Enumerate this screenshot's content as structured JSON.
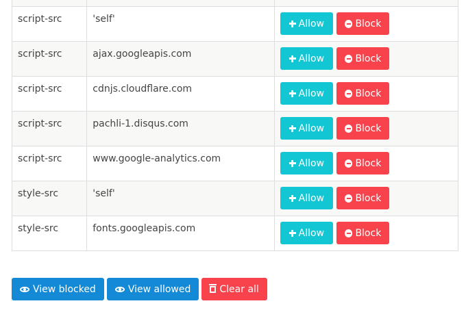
{
  "rows": [
    {
      "directive": "script-src",
      "source": "'self'"
    },
    {
      "directive": "script-src",
      "source": "ajax.googleapis.com"
    },
    {
      "directive": "script-src",
      "source": "cdnjs.cloudflare.com"
    },
    {
      "directive": "script-src",
      "source": "pachli-1.disqus.com"
    },
    {
      "directive": "script-src",
      "source": "www.google-analytics.com"
    },
    {
      "directive": "style-src",
      "source": "'self'"
    },
    {
      "directive": "style-src",
      "source": "fonts.googleapis.com"
    }
  ],
  "actions": {
    "allow_label": "Allow",
    "block_label": "Block"
  },
  "footer": {
    "view_blocked": "View blocked",
    "view_allowed": "View allowed",
    "clear_all": "Clear all"
  },
  "colors": {
    "allow": "#13c6d3",
    "block": "#f8424c",
    "primary": "#148ad6"
  },
  "icons": {
    "allow": "plus-icon",
    "block": "minus-circle-icon",
    "view": "eye-icon",
    "clear": "trash-icon"
  }
}
